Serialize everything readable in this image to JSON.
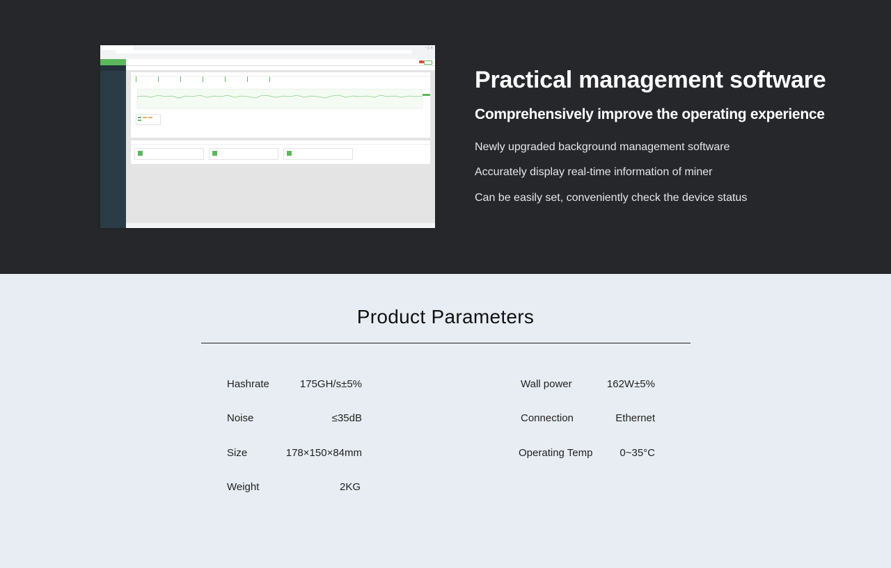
{
  "hero": {
    "title": "Practical management software",
    "subtitle": "Comprehensively improve the operating experience",
    "features": [
      "Newly upgraded background management software",
      "Accurately display real-time information of miner",
      "Can be easily set, conveniently check the device status"
    ]
  },
  "screenshot": {
    "icons": [
      "browser-window-icon",
      "chart-icon",
      "device-icon"
    ]
  },
  "params": {
    "title": "Product Parameters",
    "left": [
      {
        "label": "Hashrate",
        "value": "175GH/s±5%"
      },
      {
        "label": "Noise",
        "value": "≤35dB"
      },
      {
        "label": "Size",
        "value": "178×150×84mm"
      },
      {
        "label": "Weight",
        "value": "2KG"
      }
    ],
    "right": [
      {
        "label": "Wall power",
        "value": "162W±5%"
      },
      {
        "label": "Connection",
        "value": "Ethernet"
      },
      {
        "label": "Operating Temp",
        "value": "0~35°C"
      }
    ]
  },
  "colors": {
    "dark_bg": "#26272b",
    "light_bg": "#e8edf3",
    "accent_green": "#5cb85c"
  }
}
